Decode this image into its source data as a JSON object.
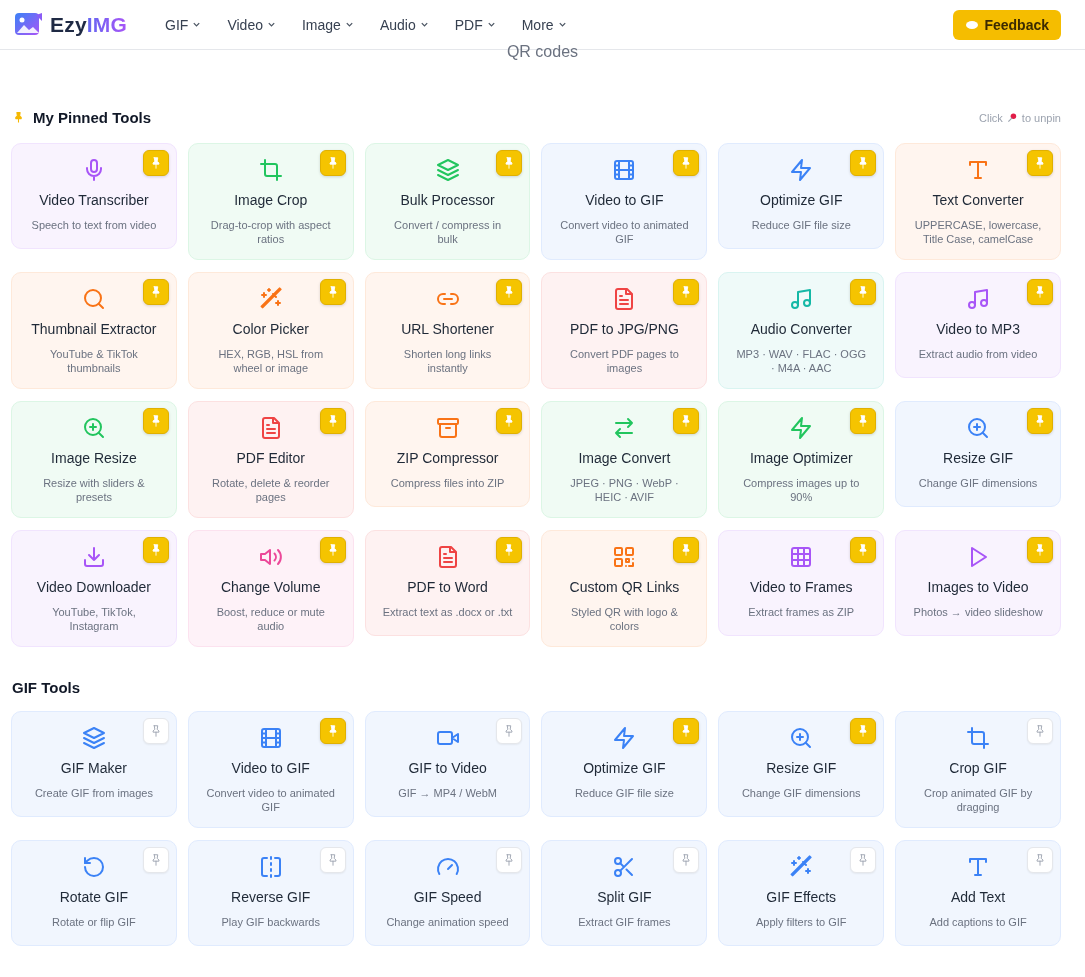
{
  "header": {
    "logo": {
      "name_part": "Ezy",
      "accent_part": "IMG"
    },
    "nav": [
      {
        "label": "GIF"
      },
      {
        "label": "Video"
      },
      {
        "label": "Image"
      },
      {
        "label": "Audio"
      },
      {
        "label": "PDF"
      },
      {
        "label": "More"
      }
    ],
    "feedback_button": "Feedback"
  },
  "cut_text": "QR codes",
  "pinned_section": {
    "title": "My Pinned Tools",
    "hint_before": "Click",
    "hint_after": "to unpin",
    "tools": [
      {
        "title": "Video Transcriber",
        "description": "Speech to text from video",
        "color": "#a855f7",
        "pinned": true
      },
      {
        "title": "Image Crop",
        "description": "Drag-to-crop with aspect ratios",
        "color": "#22c55e",
        "pinned": true
      },
      {
        "title": "Bulk Processor",
        "description": "Convert / compress in bulk",
        "color": "#22c55e",
        "pinned": true
      },
      {
        "title": "Video to GIF",
        "description": "Convert video to animated GIF",
        "color": "#3b82f6",
        "pinned": true
      },
      {
        "title": "Optimize GIF",
        "description": "Reduce GIF file size",
        "color": "#3b82f6",
        "pinned": true
      },
      {
        "title": "Text Converter",
        "description": "UPPERCASE, lowercase, Title Case, camelCase",
        "color": "#f97316",
        "pinned": true
      },
      {
        "title": "Thumbnail Extractor",
        "description": "YouTube & TikTok thumbnails",
        "color": "#f97316",
        "pinned": true
      },
      {
        "title": "Color Picker",
        "description": "HEX, RGB, HSL from wheel or image",
        "color": "#f97316",
        "pinned": true
      },
      {
        "title": "URL Shortener",
        "description": "Shorten long links instantly",
        "color": "#f97316",
        "pinned": true
      },
      {
        "title": "PDF to JPG/PNG",
        "description": "Convert PDF pages to images",
        "color": "#ef4444",
        "pinned": true
      },
      {
        "title": "Audio Converter",
        "description": "MP3 · WAV · FLAC · OGG · M4A · AAC",
        "color": "#14b8a6",
        "pinned": true
      },
      {
        "title": "Video to MP3",
        "description": "Extract audio from video",
        "color": "#a855f7",
        "pinned": true
      },
      {
        "title": "Image Resize",
        "description": "Resize with sliders & presets",
        "color": "#22c55e",
        "pinned": true
      },
      {
        "title": "PDF Editor",
        "description": "Rotate, delete & reorder pages",
        "color": "#ef4444",
        "pinned": true
      },
      {
        "title": "ZIP Compressor",
        "description": "Compress files into ZIP",
        "color": "#f97316",
        "pinned": true
      },
      {
        "title": "Image Convert",
        "description": "JPEG · PNG · WebP · HEIC · AVIF",
        "color": "#22c55e",
        "pinned": true
      },
      {
        "title": "Image Optimizer",
        "description": "Compress images up to 90%",
        "color": "#22c55e",
        "pinned": true
      },
      {
        "title": "Resize GIF",
        "description": "Change GIF dimensions",
        "color": "#3b82f6",
        "pinned": true
      },
      {
        "title": "Video Downloader",
        "description": "YouTube, TikTok, Instagram",
        "color": "#a855f7",
        "pinned": true
      },
      {
        "title": "Change Volume",
        "description": "Boost, reduce or mute audio",
        "color": "#ec4899",
        "pinned": true
      },
      {
        "title": "PDF to Word",
        "description": "Extract text as .docx or .txt",
        "color": "#ef4444",
        "pinned": true
      },
      {
        "title": "Custom QR Links",
        "description": "Styled QR with logo & colors",
        "color": "#f97316",
        "pinned": true
      },
      {
        "title": "Video to Frames",
        "description": "Extract frames as ZIP",
        "color": "#a855f7",
        "pinned": true
      },
      {
        "title": "Images to Video",
        "description": "Photos → video slideshow",
        "color": "#a855f7",
        "pinned": true
      }
    ]
  },
  "gif_section": {
    "title": "GIF Tools",
    "tools": [
      {
        "title": "GIF Maker",
        "description": "Create GIF from images",
        "color": "#3b82f6",
        "pinned": false
      },
      {
        "title": "Video to GIF",
        "description": "Convert video to animated GIF",
        "color": "#3b82f6",
        "pinned": true
      },
      {
        "title": "GIF to Video",
        "description": "GIF → MP4 / WebM",
        "color": "#3b82f6",
        "pinned": false
      },
      {
        "title": "Optimize GIF",
        "description": "Reduce GIF file size",
        "color": "#3b82f6",
        "pinned": true
      },
      {
        "title": "Resize GIF",
        "description": "Change GIF dimensions",
        "color": "#3b82f6",
        "pinned": true
      },
      {
        "title": "Crop GIF",
        "description": "Crop animated GIF by dragging",
        "color": "#3b82f6",
        "pinned": false
      },
      {
        "title": "Rotate GIF",
        "description": "Rotate or flip GIF",
        "color": "#3b82f6",
        "pinned": false
      },
      {
        "title": "Reverse GIF",
        "description": "Play GIF backwards",
        "color": "#3b82f6",
        "pinned": false
      },
      {
        "title": "GIF Speed",
        "description": "Change animation speed",
        "color": "#3b82f6",
        "pinned": false
      },
      {
        "title": "Split GIF",
        "description": "Extract GIF frames",
        "color": "#3b82f6",
        "pinned": false
      },
      {
        "title": "GIF Effects",
        "description": "Apply filters to GIF",
        "color": "#3b82f6",
        "pinned": false
      },
      {
        "title": "Add Text",
        "description": "Add captions to GIF",
        "color": "#3b82f6",
        "pinned": false
      }
    ]
  }
}
